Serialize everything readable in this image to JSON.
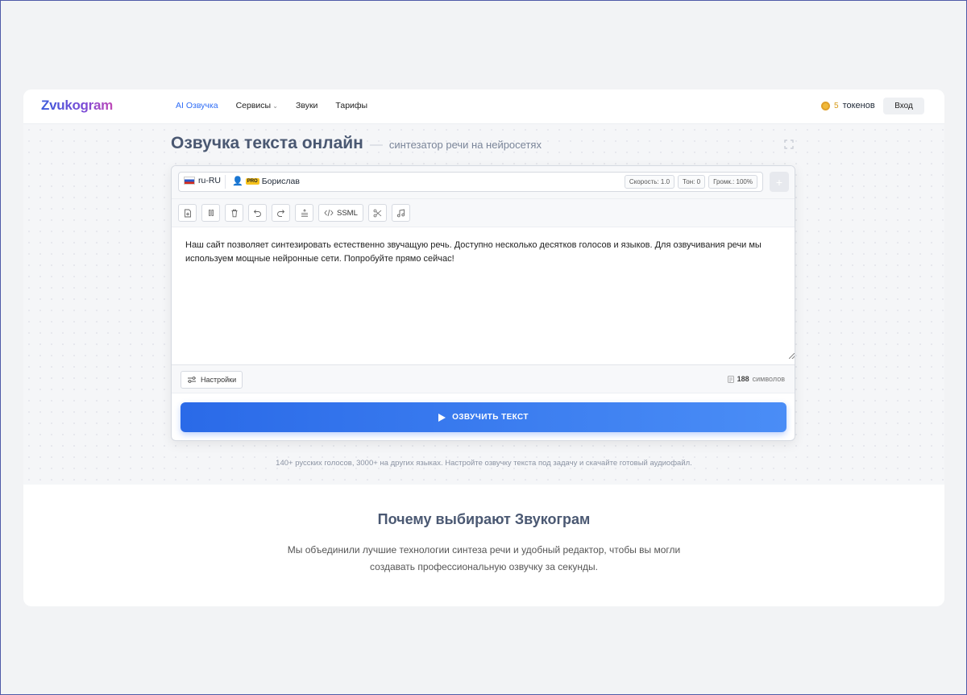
{
  "header": {
    "logo": "Zvukogram",
    "nav": [
      {
        "label": "AI Озвучка"
      },
      {
        "label": "Сервисы"
      },
      {
        "label": "Звуки"
      },
      {
        "label": "Тарифы"
      }
    ],
    "tokens_count": "5",
    "tokens_label": "токенов",
    "login": "Вход"
  },
  "hero": {
    "title": "Озвучка текста онлайн",
    "dash": "—",
    "subtitle": "синтезатор речи на нейросетях"
  },
  "editor": {
    "language": "ru-RU",
    "pro_badge": "PRO",
    "voice": "Борислав",
    "speed": "Скорость: 1.0",
    "pitch": "Тон: 0",
    "volume": "Громк.: 100%",
    "plus": "+",
    "ssml": "SSML",
    "text": "Наш сайт позволяет синтезировать естественно звучащую речь. Доступно несколько десятков голосов и языков. Для озвучивания речи мы используем мощные нейронные сети. Попробуйте прямо сейчас!",
    "settings": "Настройки",
    "char_count": "188",
    "char_label": "символов",
    "speak": "ОЗВУЧИТЬ ТЕКСТ"
  },
  "hint": "140+ русских голосов, 3000+ на других языках. Настройте озвучку текста под задачу и скачайте готовый аудиофайл.",
  "why": {
    "title": "Почему выбирают Звукограм",
    "line1": "Мы объединили лучшие технологии синтеза речи и удобный редактор, чтобы вы могли",
    "line2": "создавать профессиональную озвучку за секунды."
  },
  "colors": {
    "accent": "#2f6df6",
    "title": "#4a5872",
    "coin": "#f0b93a"
  }
}
